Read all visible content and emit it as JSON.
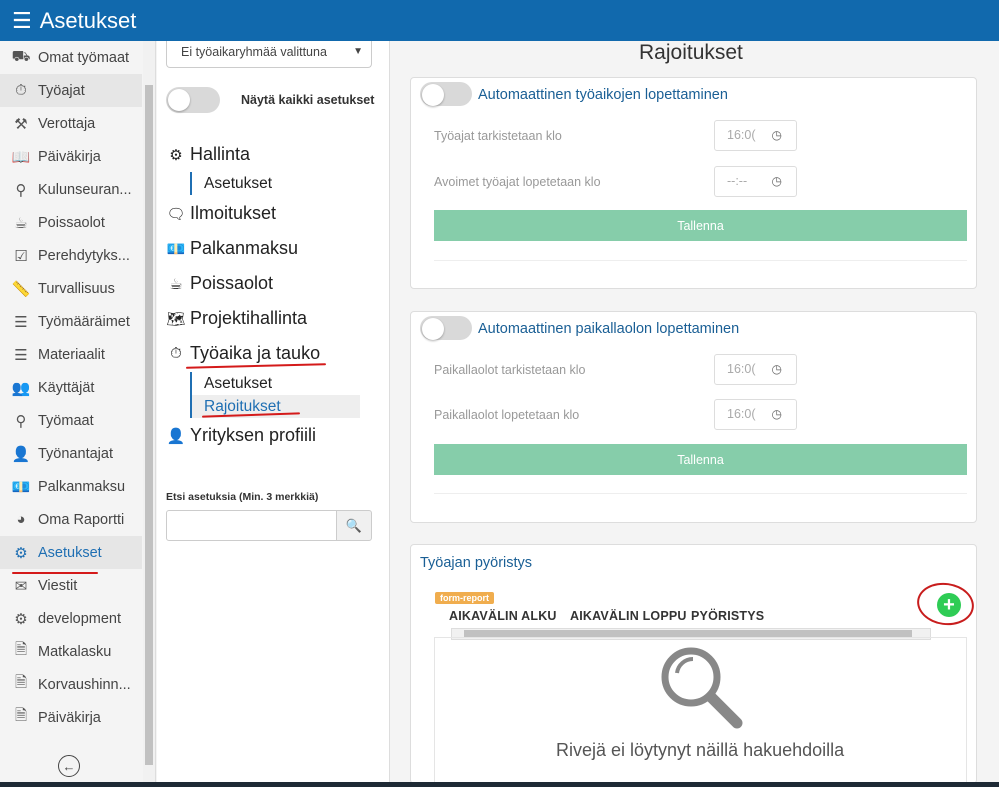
{
  "header": {
    "title": "Asetukset",
    "menu_icon": "hamburger-icon"
  },
  "sidebar": {
    "items": [
      {
        "label": "Omat työmaat",
        "icon": "construction-icon",
        "glyph": "⛟"
      },
      {
        "label": "Työajat",
        "icon": "stopwatch-icon",
        "glyph": "⏱"
      },
      {
        "label": "Verottaja",
        "icon": "gavel-icon",
        "glyph": "⚒"
      },
      {
        "label": "Päiväkirja",
        "icon": "book-icon",
        "glyph": "📖"
      },
      {
        "label": "Kulunseuran...",
        "icon": "map-pin-icon",
        "glyph": "⚲"
      },
      {
        "label": "Poissaolot",
        "icon": "coffee-icon",
        "glyph": "☕"
      },
      {
        "label": "Perehdytyks...",
        "icon": "checklist-icon",
        "glyph": "☑"
      },
      {
        "label": "Turvallisuus",
        "icon": "ruler-icon",
        "glyph": "📏"
      },
      {
        "label": "Työmääräimet",
        "icon": "list-icon",
        "glyph": "☰"
      },
      {
        "label": "Materiaalit",
        "icon": "list-icon",
        "glyph": "☰"
      },
      {
        "label": "Käyttäjät",
        "icon": "users-icon",
        "glyph": "👥"
      },
      {
        "label": "Työmaat",
        "icon": "location-icon",
        "glyph": "⚲"
      },
      {
        "label": "Työnantajat",
        "icon": "user-icon",
        "glyph": "👤"
      },
      {
        "label": "Palkanmaksu",
        "icon": "money-icon",
        "glyph": "💶"
      },
      {
        "label": "Oma Raportti",
        "icon": "pie-chart-icon",
        "glyph": "◕"
      },
      {
        "label": "Asetukset",
        "icon": "gear-icon",
        "glyph": "⚙"
      },
      {
        "label": "Viestit",
        "icon": "envelope-icon",
        "glyph": "✉"
      },
      {
        "label": "development",
        "icon": "gear-icon",
        "glyph": "⚙"
      },
      {
        "label": "Matkalasku",
        "icon": "document-icon",
        "glyph": "🗎"
      },
      {
        "label": "Korvaushinn...",
        "icon": "document-icon",
        "glyph": "🗎"
      },
      {
        "label": "Päiväkirja",
        "icon": "document-icon",
        "glyph": "🗎"
      }
    ],
    "collapse_icon": "arrow-left-circle-icon"
  },
  "settings_nav": {
    "group_select": "Ei työaikaryhmää valittuna",
    "show_all_label": "Näytä kaikki asetukset",
    "groups": [
      {
        "label": "Hallinta",
        "icon": "gear-icon"
      },
      {
        "label": "Ilmoitukset",
        "icon": "message-icon"
      },
      {
        "label": "Palkanmaksu",
        "icon": "money-icon"
      },
      {
        "label": "Poissaolot",
        "icon": "coffee-icon"
      },
      {
        "label": "Projektihallinta",
        "icon": "map-icon"
      },
      {
        "label": "Työaika ja tauko",
        "icon": "stopwatch-icon"
      },
      {
        "label": "Yrityksen profiili",
        "icon": "user-icon"
      }
    ],
    "hallinta_sub": [
      "Asetukset"
    ],
    "tyoaika_sub": [
      "Asetukset",
      "Rajoitukset"
    ],
    "search_label": "Etsi asetuksia (Min. 3 merkkiä)",
    "search_value": ""
  },
  "main": {
    "title": "Rajoitukset",
    "card1": {
      "title": "Automaattinen työaikojen lopettaminen",
      "field1_label": "Työajat tarkistetaan klo",
      "field1_value": "16:0(",
      "field2_label": "Avoimet työajat lopetetaan klo",
      "field2_value": "--:--",
      "save_label": "Tallenna"
    },
    "card2": {
      "title": "Automaattinen paikallaolon lopettaminen",
      "field1_label": "Paikallaolot tarkistetaan klo",
      "field1_value": "16:0(",
      "field2_label": "Paikallaolot lopetetaan klo",
      "field2_value": "16:0(",
      "save_label": "Tallenna"
    },
    "card3": {
      "title": "Työajan pyöristys",
      "tag": "form-report",
      "columns": [
        "AIKAVÄLIN ALKU",
        "AIKAVÄLIN LOPPU",
        "PYÖRISTYS"
      ],
      "empty_text": "Rivejä ei löytynyt näillä hakuehdoilla"
    }
  },
  "colors": {
    "header": "#1169ad",
    "save": "#86cdaa",
    "add": "#2ecc55",
    "annotation": "#d41a1a"
  }
}
